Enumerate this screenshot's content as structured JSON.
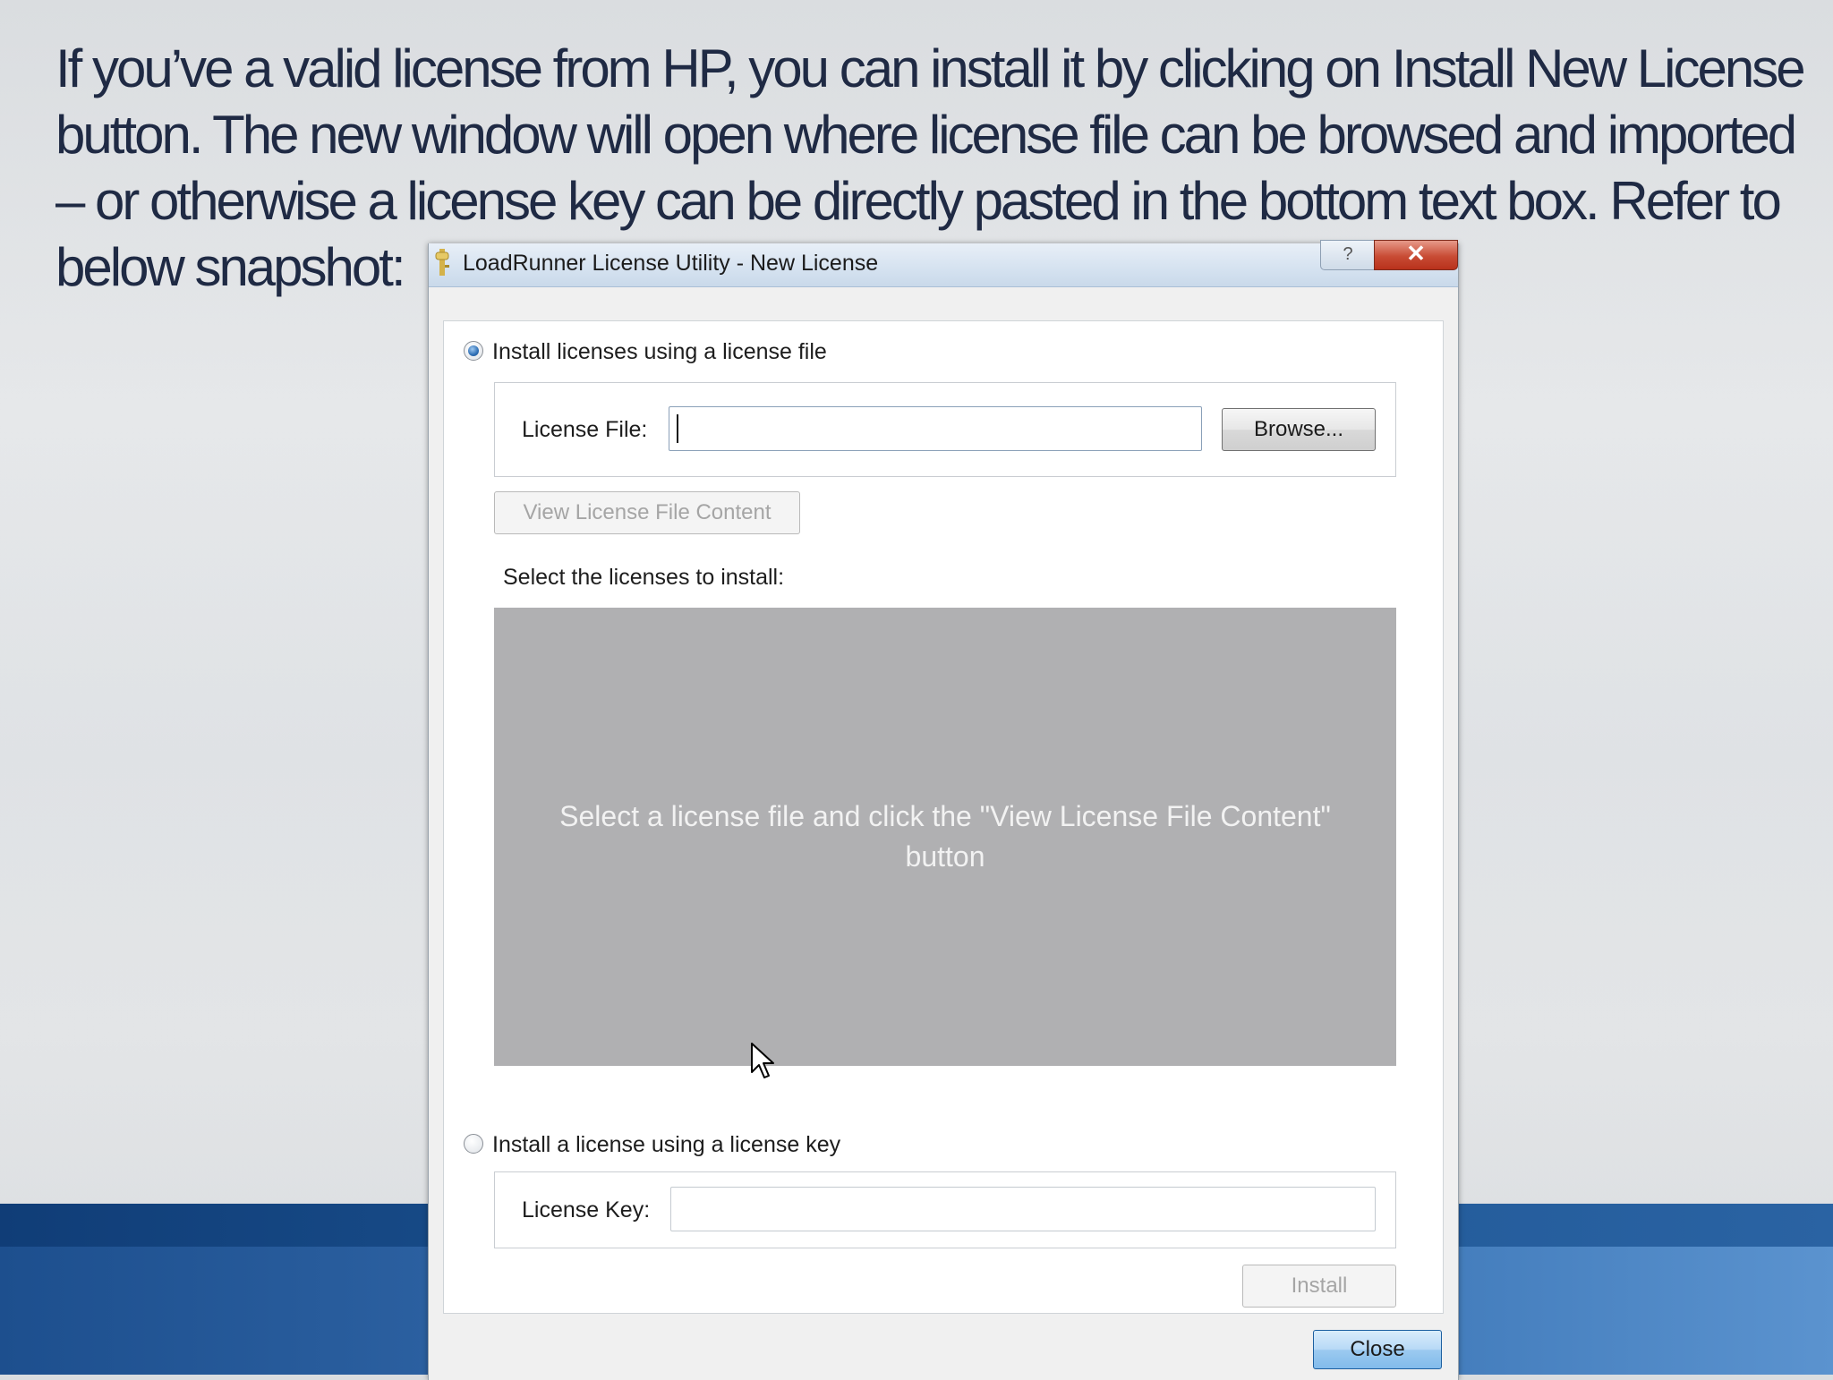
{
  "slide": {
    "text": "If you’ve a valid license from HP, you can install it by clicking on Install New License button. The new window will open where license file can be browsed and imported – or otherwise a license key can be directly pasted in the bottom text box. Refer to below snapshot:"
  },
  "window": {
    "title": "LoadRunner License Utility - New License",
    "help_glyph": "?",
    "close_glyph": "✕"
  },
  "file_option": {
    "radio_label": "Install licenses using a license file",
    "selected": true,
    "field_label": "License File:",
    "field_value": "",
    "browse_label": "Browse...",
    "view_button_label": "View License File Content",
    "select_label": "Select the licenses to install:",
    "panel_message": "Select a license file and click the \"View License File Content\" button"
  },
  "key_option": {
    "radio_label": "Install a license using a license key",
    "selected": false,
    "field_label": "License Key:",
    "field_value": ""
  },
  "buttons": {
    "install_label": "Install",
    "close_label": "Close"
  },
  "icons": {
    "app": "key-icon",
    "pointer": "mouse-pointer-icon"
  }
}
